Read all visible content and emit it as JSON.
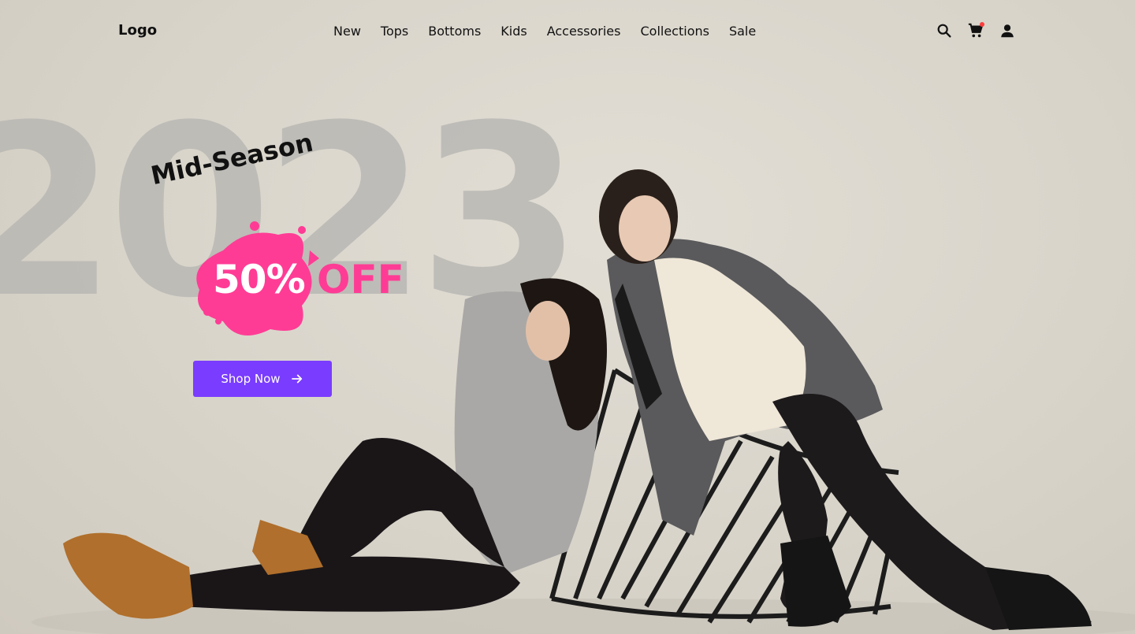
{
  "header": {
    "logo": "Logo",
    "nav": [
      "New",
      "Tops",
      "Bottoms",
      "Kids",
      "Accessories",
      "Collections",
      "Sale"
    ],
    "icons": [
      "search-icon",
      "cart-icon",
      "user-icon"
    ],
    "cart_badge_color": "#ff3b3b"
  },
  "hero": {
    "year": "2023",
    "tagline": "Mid-Season",
    "discount": "50%",
    "off": "OFF",
    "cta_label": "Shop Now",
    "colors": {
      "accent_pink": "#ff3c95",
      "button_purple": "#7a3cff",
      "background": "#d9d5cb"
    }
  }
}
